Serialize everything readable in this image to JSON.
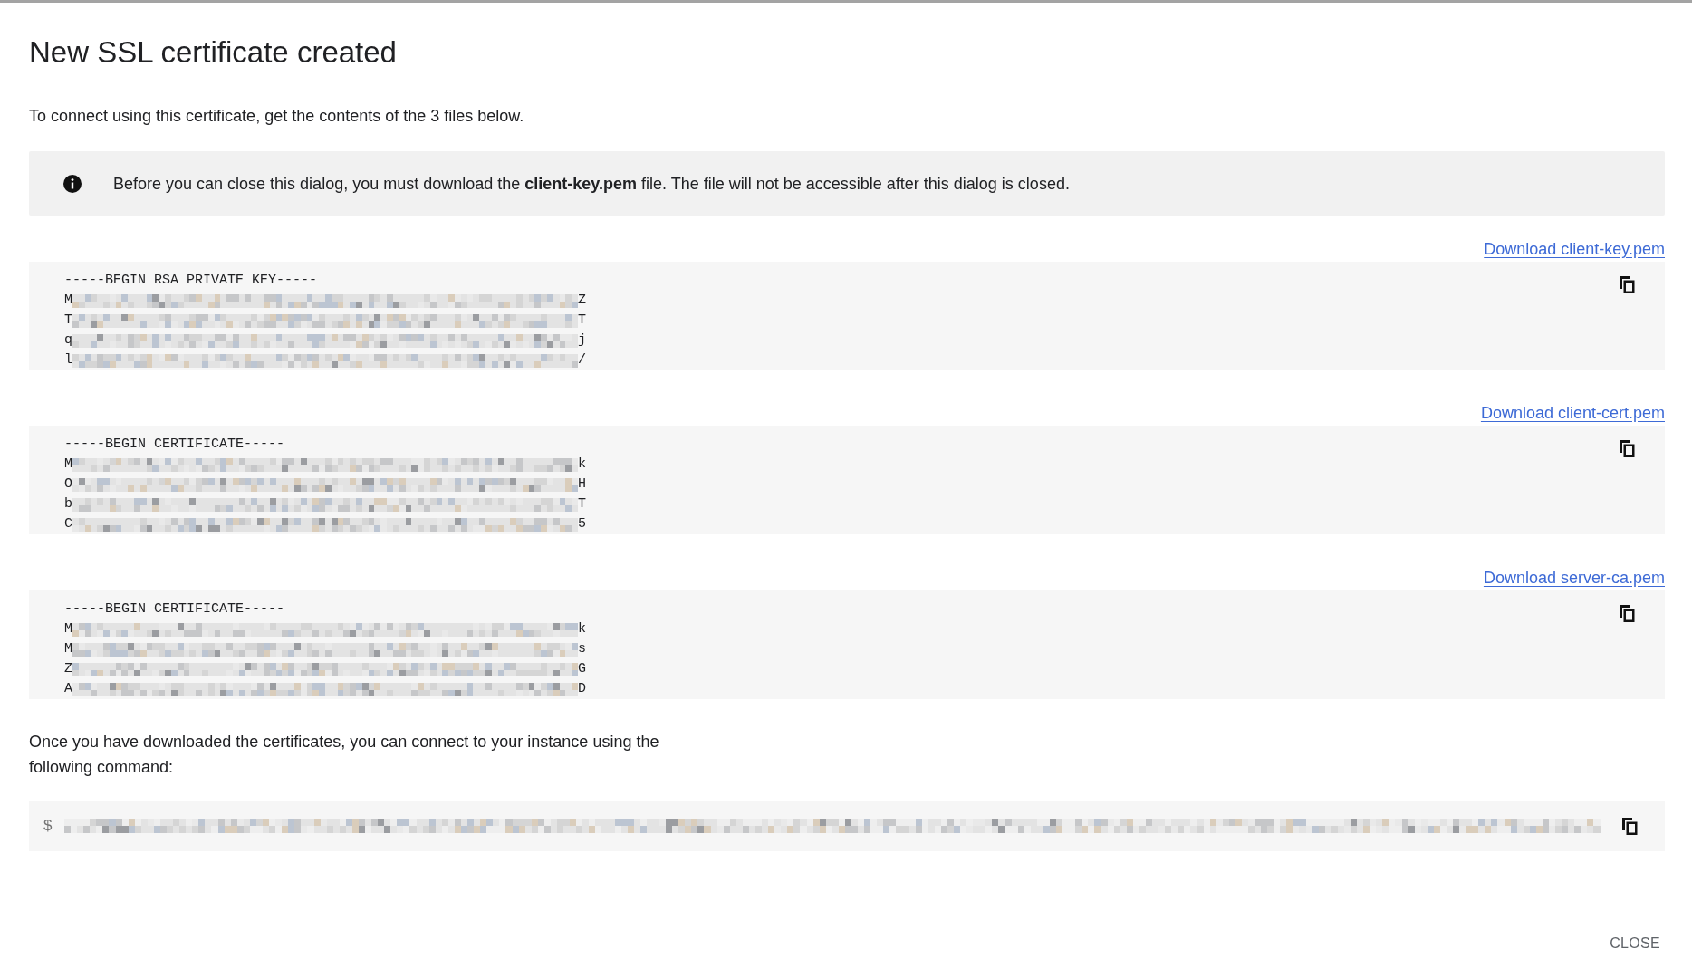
{
  "dialog": {
    "title": "New SSL certificate created",
    "intro": "To connect using this certificate, get the contents of the 3 files below.",
    "notice": {
      "text": "Before you can close this dialog, you must download the **client-key.pem** file. The file will not be accessible after this dialog is closed."
    },
    "files": [
      {
        "download_link": "Download client-key.pem",
        "lines": [
          {
            "kind": "text",
            "text": "-----BEGIN RSA PRIVATE KEY-----"
          },
          {
            "kind": "redacted",
            "start": "M",
            "end": "Z"
          },
          {
            "kind": "redacted",
            "start": "T",
            "end": "T"
          },
          {
            "kind": "redacted",
            "start": "q",
            "end": "j"
          },
          {
            "kind": "redacted",
            "start": "l",
            "end": "/"
          }
        ]
      },
      {
        "download_link": "Download client-cert.pem",
        "lines": [
          {
            "kind": "text",
            "text": "-----BEGIN CERTIFICATE-----"
          },
          {
            "kind": "redacted",
            "start": "M",
            "end": "k"
          },
          {
            "kind": "redacted",
            "start": "O",
            "end": "H"
          },
          {
            "kind": "redacted",
            "start": "b",
            "end": "T"
          },
          {
            "kind": "redacted",
            "start": "C",
            "end": "5"
          }
        ]
      },
      {
        "download_link": "Download server-ca.pem",
        "lines": [
          {
            "kind": "text",
            "text": "-----BEGIN CERTIFICATE-----"
          },
          {
            "kind": "redacted",
            "start": "M",
            "end": "k"
          },
          {
            "kind": "redacted",
            "start": "M",
            "end": "s"
          },
          {
            "kind": "redacted",
            "start": "Z",
            "end": "G"
          },
          {
            "kind": "redacted",
            "start": "A",
            "end": "D"
          }
        ]
      }
    ],
    "command_intro": "Once you have downloaded the certificates, you can connect to your instance using the following command:",
    "command": {
      "prompt": "$",
      "kind": "redacted"
    },
    "buttons": [
      {
        "label": "CLOSE"
      }
    ]
  }
}
